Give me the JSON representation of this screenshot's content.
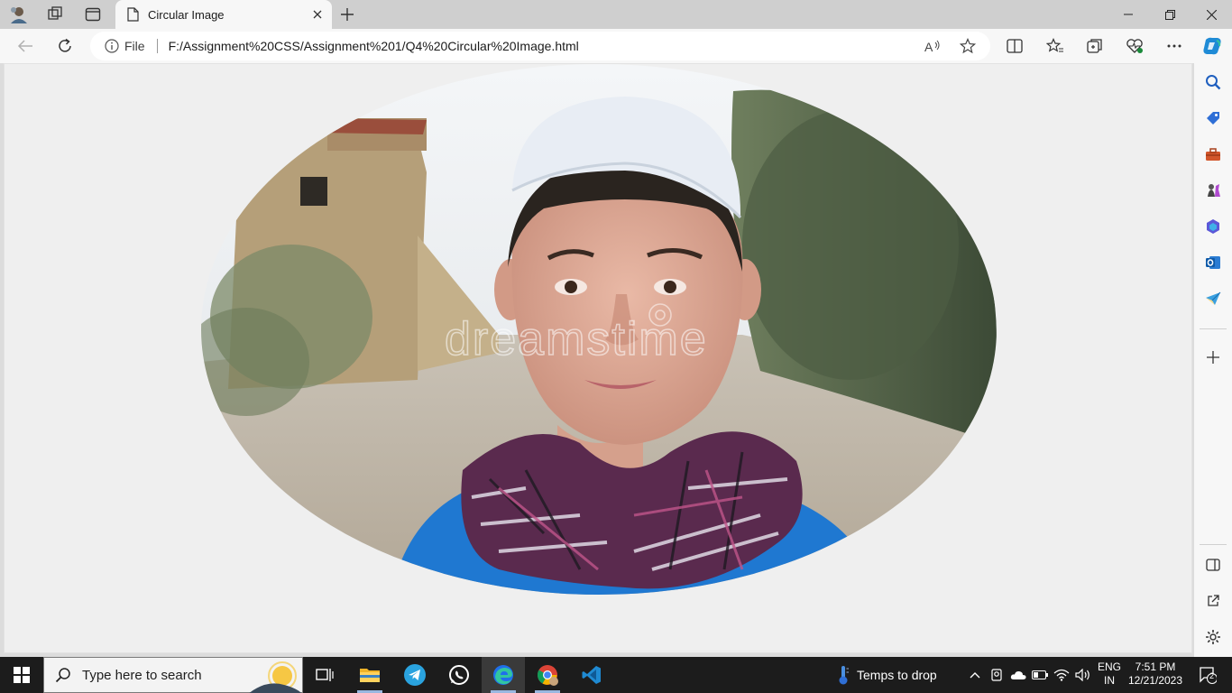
{
  "tab": {
    "title": "Circular Image"
  },
  "address": {
    "file_label": "File",
    "url": "F:/Assignment%20CSS/Assignment%201/Q4%20Circular%20Image.html"
  },
  "taskbar": {
    "search_placeholder": "Type here to search",
    "weather_text": "Temps to drop",
    "lang_line1": "ENG",
    "lang_line2": "IN",
    "time": "7:51 PM",
    "date": "12/21/2023",
    "notification_count": "2"
  },
  "image": {
    "watermark": "dreamstime"
  },
  "colors": {
    "page_bg": "#efefef",
    "taskbar_bg": "#1c1c1c",
    "edge_accent": "#1f6feb",
    "shirt_blue": "#1f78d1"
  }
}
